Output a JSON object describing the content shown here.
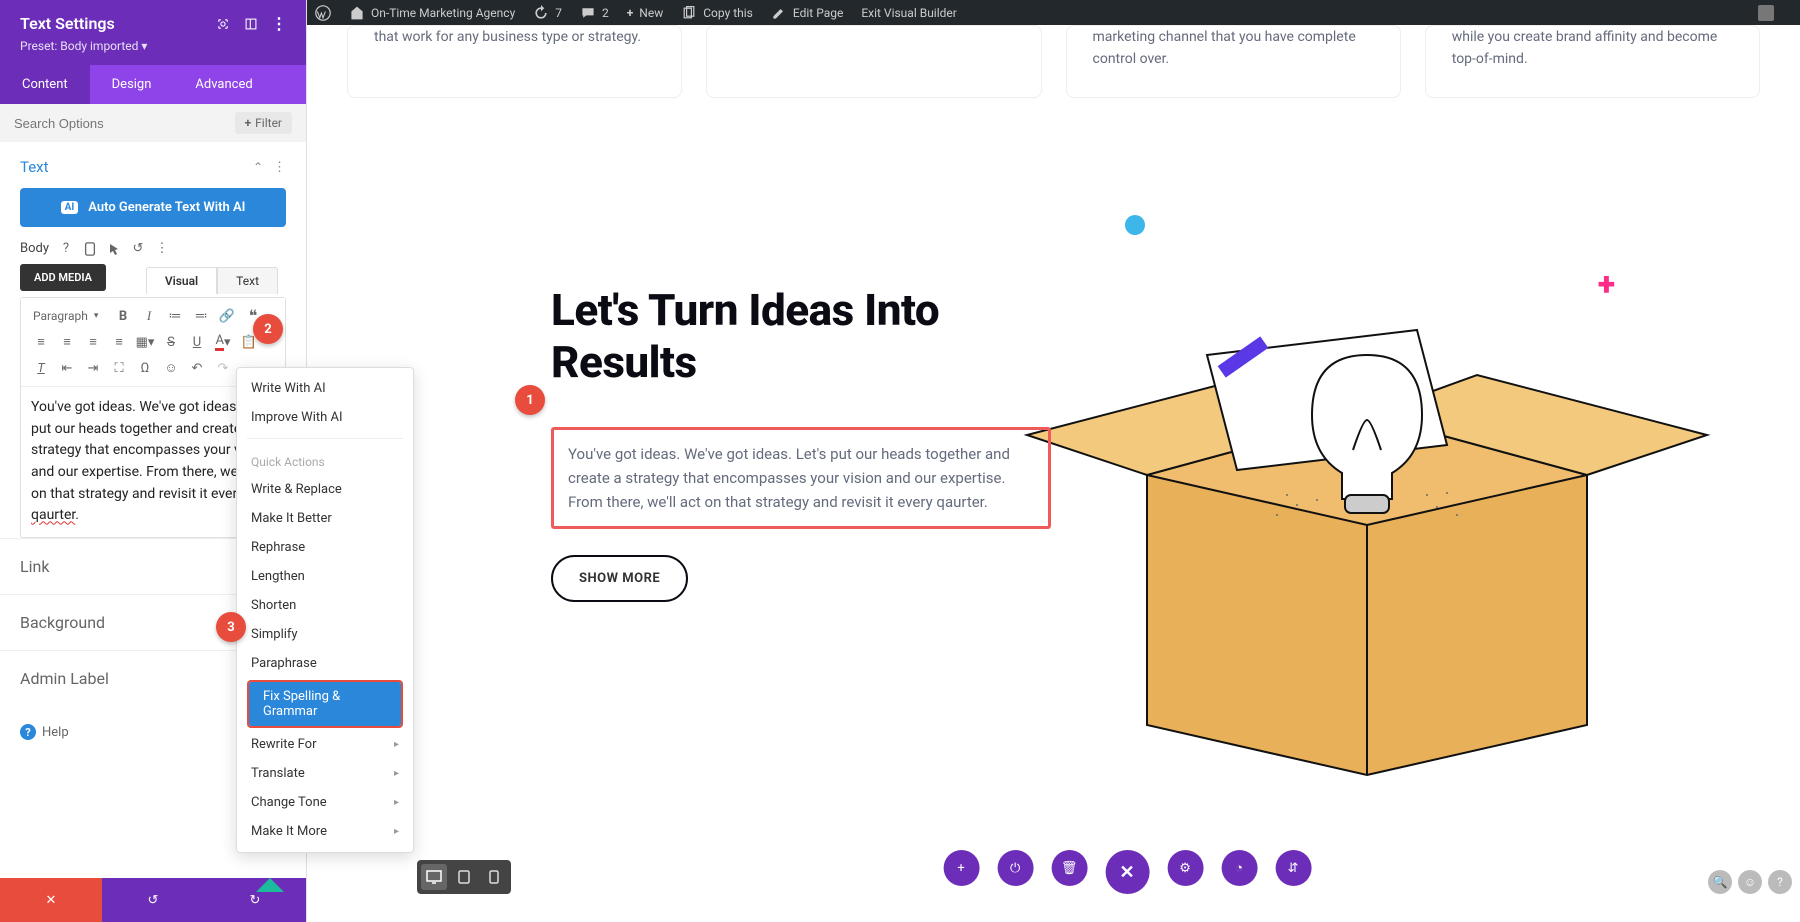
{
  "adminbar": {
    "site": "On-Time Marketing Agency",
    "updates": "7",
    "comments": "2",
    "new": "New",
    "copy": "Copy this",
    "edit": "Edit Page",
    "exit": "Exit Visual Builder"
  },
  "sidebar": {
    "title": "Text Settings",
    "preset": "Preset: Body imported ▾",
    "tabs": {
      "content": "Content",
      "design": "Design",
      "advanced": "Advanced"
    },
    "search": {
      "placeholder": "Search Options",
      "filter": "Filter"
    },
    "section_text": "Text",
    "ai_button": "Auto Generate Text With AI",
    "body_label": "Body",
    "add_media": "ADD MEDIA",
    "editor_tabs": {
      "visual": "Visual",
      "text": "Text"
    },
    "ai_icon_label": "AI",
    "paragraph_label": "Paragraph",
    "editor_text_prefix": "You've got ideas. We've got ideas. Let's put our heads together and create a strategy that encompasses your vision and our expertise. From there, we'll act on that strategy and revisit it every ",
    "editor_text_misspell": "qaurter",
    "editor_text_suffix": ".",
    "link": "Link",
    "background": "Background",
    "admin_label": "Admin Label",
    "help": "Help"
  },
  "ai_menu": {
    "items_top": [
      "Write With AI",
      "Improve With AI"
    ],
    "quick_header": "Quick Actions",
    "items_quick": [
      "Write & Replace",
      "Make It Better",
      "Rephrase",
      "Lengthen",
      "Shorten",
      "Simplify",
      "Paraphrase"
    ],
    "highlight": "Fix Spelling & Grammar",
    "items_sub": [
      "Rewrite For",
      "Translate",
      "Change Tone",
      "Make It More"
    ]
  },
  "canvas": {
    "cards": [
      "that work for any business type or strategy.",
      "",
      "marketing channel that you have complete control over.",
      "while you create brand affinity and become top-of-mind."
    ],
    "hero_title": "Let's Turn Ideas Into Results",
    "hero_sub": "You've got ideas. We've got ideas. Let's put our heads together and create a strategy that encompasses your vision and our expertise. From there, we'll act on that strategy and revisit it every qaurter.",
    "show_more": "SHOW MORE"
  },
  "badges": {
    "b1": "1",
    "b2": "2",
    "b3": "3"
  }
}
